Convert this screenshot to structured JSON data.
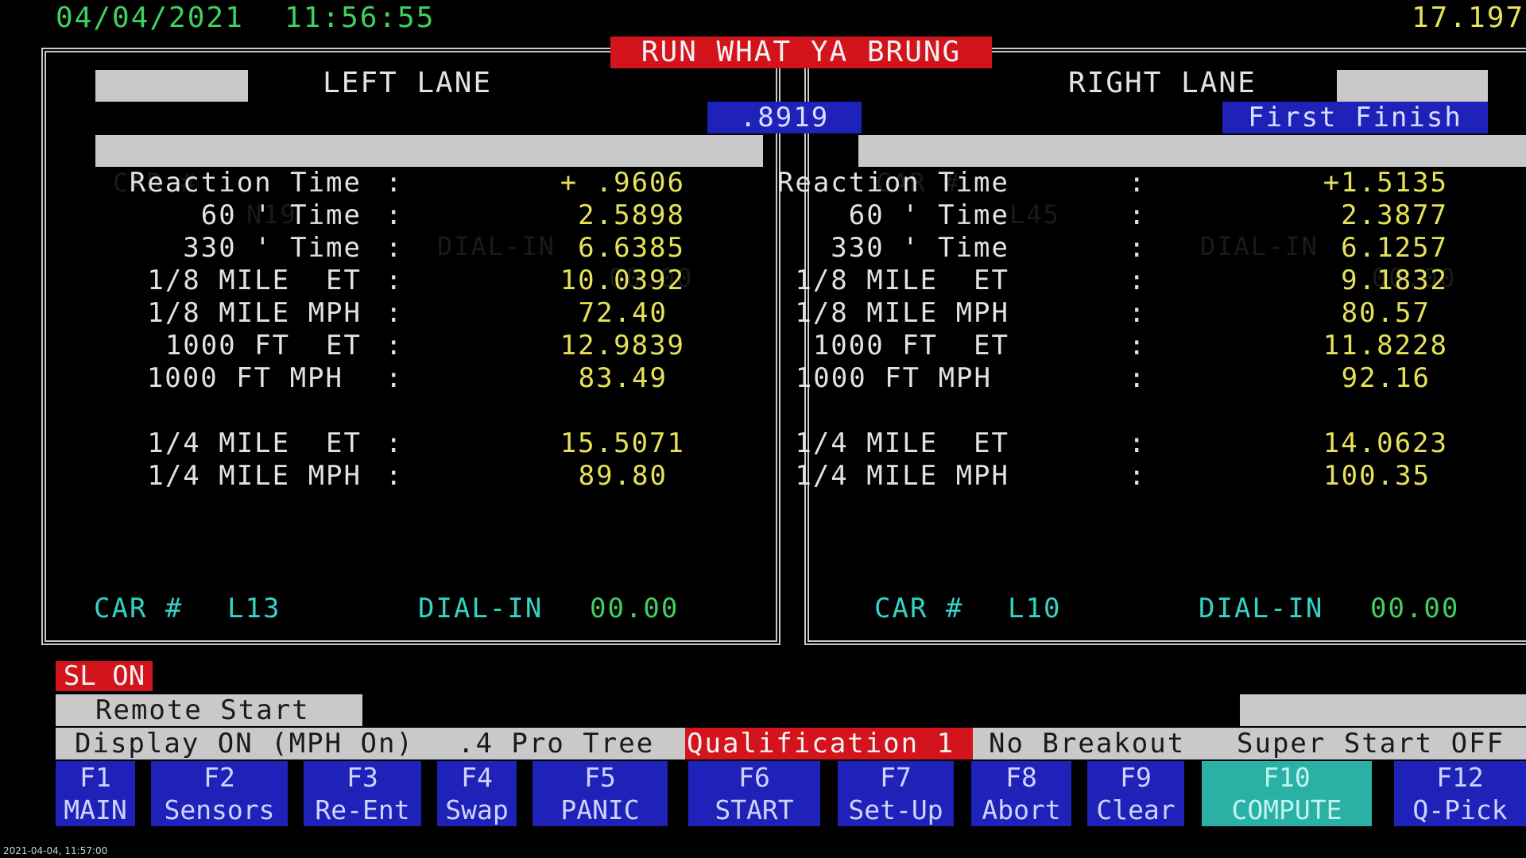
{
  "header": {
    "date": "04/04/2021",
    "time": "11:56:55",
    "top_right_value": "17.197",
    "title": "RUN WHAT YA BRUNG",
    "center_value": ".8919"
  },
  "left_lane": {
    "title": "LEFT LANE",
    "car_label": "CAR #",
    "car_number": "N19",
    "dial_in_label": "DIAL-IN",
    "dial_in": "00.00",
    "rows": [
      {
        "label": "Reaction Time",
        "value": "+ .9606"
      },
      {
        "label": "60 ' Time",
        "value": "2.5898"
      },
      {
        "label": "330 ' Time",
        "value": "6.6385"
      },
      {
        "label": "1/8 MILE  ET",
        "value": "10.0392"
      },
      {
        "label": "1/8 MILE MPH",
        "value": "72.40"
      },
      {
        "label": "1000 FT  ET",
        "value": "12.9839"
      },
      {
        "label": "1000 FT MPH",
        "value": "83.49"
      },
      {
        "label": "1/4 MILE  ET",
        "value": "15.5071"
      },
      {
        "label": "1/4 MILE MPH",
        "value": "89.80"
      }
    ],
    "next_car_label": "CAR #",
    "next_car": "L13",
    "next_dial_label": "DIAL-IN",
    "next_dial": "00.00"
  },
  "right_lane": {
    "title": "RIGHT LANE",
    "result_badge": "First Finish",
    "car_label": "CAR #",
    "car_number": "L45",
    "dial_in_label": "DIAL-IN",
    "dial_in": "00.00",
    "rows": [
      {
        "label": "Reaction Time",
        "value": "+1.5135"
      },
      {
        "label": "60 ' Time",
        "value": "2.3877"
      },
      {
        "label": "330 ' Time",
        "value": "6.1257"
      },
      {
        "label": "1/8 MILE  ET",
        "value": "9.1832"
      },
      {
        "label": "1/8 MILE MPH",
        "value": "80.57"
      },
      {
        "label": "1000 FT  ET",
        "value": "11.8228"
      },
      {
        "label": "1000 FT MPH",
        "value": "92.16"
      },
      {
        "label": "1/4 MILE  ET",
        "value": "14.0623"
      },
      {
        "label": "1/4 MILE MPH",
        "value": "100.35"
      }
    ],
    "next_car_label": "CAR #",
    "next_car": "L10",
    "next_dial_label": "DIAL-IN",
    "next_dial": "00.00"
  },
  "status": {
    "sl_badge": "SL ON",
    "remote_start": "Remote Start",
    "display": "Display ON (MPH On)",
    "tree": ".4 Pro Tree",
    "qualification": "Qualification 1",
    "breakout": "No Breakout",
    "super_start": "Super Start OFF"
  },
  "function_keys": [
    {
      "key": "F1",
      "label": "MAIN"
    },
    {
      "key": "F2",
      "label": "Sensors"
    },
    {
      "key": "F3",
      "label": "Re-Ent"
    },
    {
      "key": "F4",
      "label": "Swap"
    },
    {
      "key": "F5",
      "label": "PANIC"
    },
    {
      "key": "F6",
      "label": "START"
    },
    {
      "key": "F7",
      "label": "Set-Up"
    },
    {
      "key": "F8",
      "label": "Abort"
    },
    {
      "key": "F9",
      "label": "Clear"
    },
    {
      "key": "F10",
      "label": "COMPUTE"
    },
    {
      "key": "F12",
      "label": "Q-Pick"
    }
  ],
  "overlay_timestamp": "2021-04-04, 11:57:00",
  "colors": {
    "background": "#000000",
    "title_red": "#d4141c",
    "fkey_blue": "#1f22b8",
    "selected_teal": "#2bb0a6",
    "panel_gray": "#c9c9c9"
  }
}
